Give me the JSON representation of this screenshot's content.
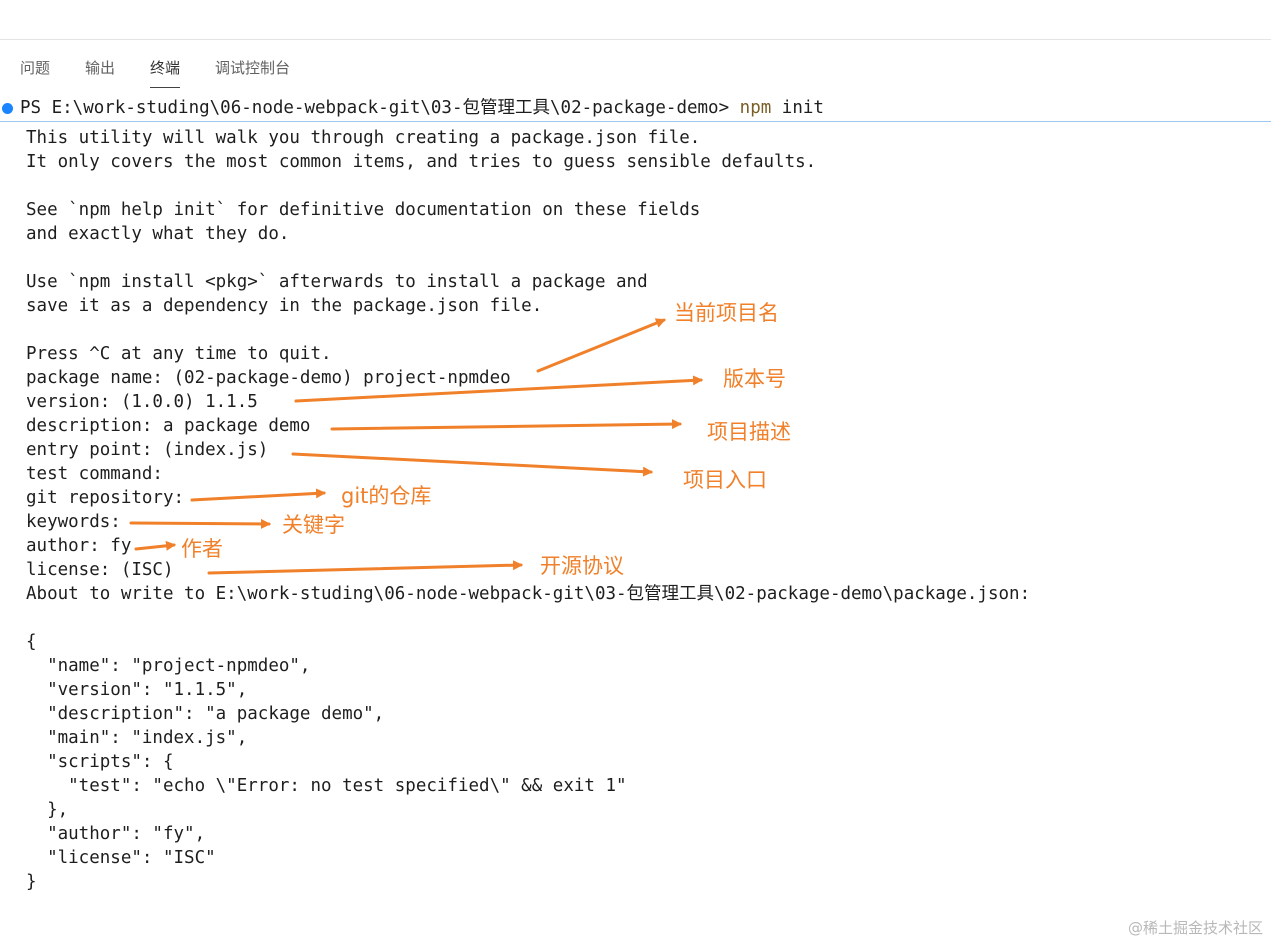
{
  "tabs": [
    {
      "label": "问题"
    },
    {
      "label": "输出"
    },
    {
      "label": "终端"
    },
    {
      "label": "调试控制台"
    }
  ],
  "prompt": {
    "path": "PS E:\\work-studing\\06-node-webpack-git\\03-包管理工具\\02-package-demo> ",
    "command": "npm",
    "args": " init"
  },
  "terminal_lines": [
    "This utility will walk you through creating a package.json file.",
    "It only covers the most common items, and tries to guess sensible defaults.",
    "",
    "See `npm help init` for definitive documentation on these fields",
    "and exactly what they do.",
    "",
    "Use `npm install <pkg>` afterwards to install a package and",
    "save it as a dependency in the package.json file.",
    "",
    "Press ^C at any time to quit.",
    "package name: (02-package-demo) project-npmdeo",
    "version: (1.0.0) 1.1.5",
    "description: a package demo",
    "entry point: (index.js)",
    "test command:",
    "git repository:",
    "keywords:",
    "author: fy",
    "license: (ISC)",
    "About to write to E:\\work-studing\\06-node-webpack-git\\03-包管理工具\\02-package-demo\\package.json:",
    "",
    "{",
    "  \"name\": \"project-npmdeo\",",
    "  \"version\": \"1.1.5\",",
    "  \"description\": \"a package demo\",",
    "  \"main\": \"index.js\",",
    "  \"scripts\": {",
    "    \"test\": \"echo \\\"Error: no test specified\\\" && exit 1\"",
    "  },",
    "  \"author\": \"fy\",",
    "  \"license\": \"ISC\"",
    "}"
  ],
  "annotations": [
    {
      "label": "当前项目名"
    },
    {
      "label": "版本号"
    },
    {
      "label": "项目描述"
    },
    {
      "label": "项目入口"
    },
    {
      "label": "git的仓库"
    },
    {
      "label": "关键字"
    },
    {
      "label": "作者"
    },
    {
      "label": "开源协议"
    }
  ],
  "watermark": "@稀土掘金技术社区",
  "colors": {
    "annotation": "#f0802a",
    "prompt_dot": "#1a85ff",
    "command": "#795e26"
  }
}
